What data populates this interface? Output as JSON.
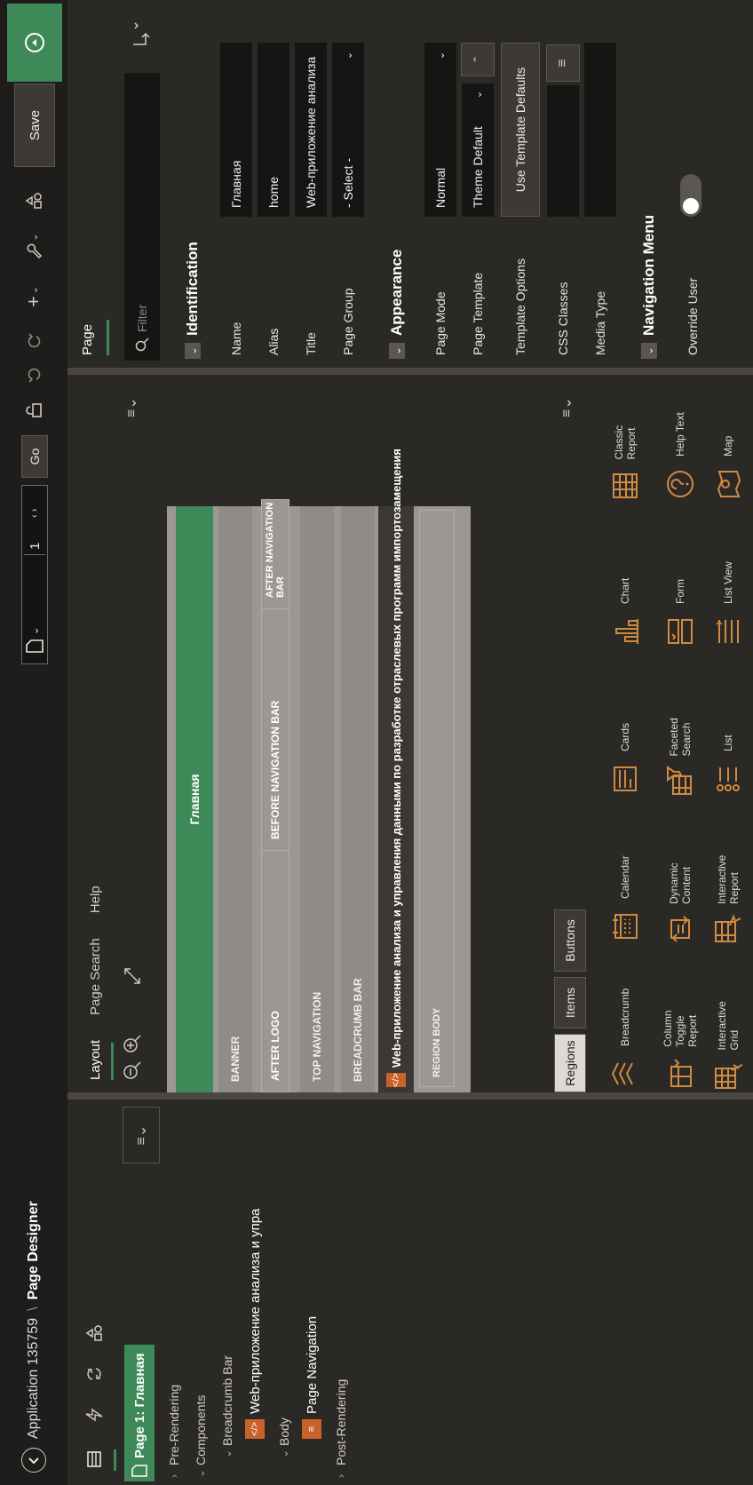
{
  "header": {
    "app_label": "Application 135759",
    "separator": "\\",
    "title": "Page Designer",
    "page_number": "1",
    "go_label": "Go",
    "save_label": "Save"
  },
  "left_panel": {
    "tree": [
      {
        "label": "Page 1: Главная",
        "selected": true
      },
      {
        "label": "Pre-Rendering"
      },
      {
        "label": "Components"
      },
      {
        "label": "Breadcrumb Bar"
      },
      {
        "label": "Web-приложение анализа и упра"
      },
      {
        "label": "Body"
      },
      {
        "label": "Page Navigation"
      },
      {
        "label": "Post-Rendering"
      }
    ]
  },
  "center": {
    "tabs": [
      "Layout",
      "Page Search",
      "Help"
    ],
    "layout": {
      "page_title": "Главная",
      "rows": {
        "banner": "BANNER",
        "after_logo": "AFTER LOGO",
        "before_nav": "BEFORE NAVIGATION BAR",
        "after_nav": "AFTER NAVIGATION BAR",
        "top_nav": "TOP NAVIGATION",
        "breadcrumb": "BREADCRUMB BAR",
        "region_title": "Web-приложение анализа и управления данными по разработке отраслевых программ импортозамещения",
        "region_body": "REGION BODY"
      }
    },
    "gallery": {
      "tabs": [
        "Regions",
        "Items",
        "Buttons"
      ],
      "items": [
        "Breadcrumb",
        "Calendar",
        "Cards",
        "Chart",
        "Classic Report",
        "Column Toggle Report",
        "Dynamic Content",
        "Faceted Search",
        "Form",
        "Help Text",
        "Interactive Grid",
        "Interactive Report",
        "List",
        "List View",
        "Map"
      ]
    }
  },
  "right_panel": {
    "tab": "Page",
    "filter_placeholder": "Filter",
    "identification": {
      "title": "Identification",
      "name_label": "Name",
      "name_value": "Главная",
      "alias_label": "Alias",
      "alias_value": "home",
      "title_label": "Title",
      "title_value": "Web-приложение анализа",
      "group_label": "Page Group",
      "group_value": "- Select -"
    },
    "appearance": {
      "title": "Appearance",
      "mode_label": "Page Mode",
      "mode_value": "Normal",
      "template_label": "Page Template",
      "template_value": "Theme Default",
      "options_label": "Template Options",
      "options_value": "Use Template Defaults",
      "css_label": "CSS Classes",
      "media_label": "Media Type"
    },
    "navigation": {
      "title": "Navigation Menu",
      "override_label": "Override User"
    }
  },
  "colors": {
    "accent": "#3d8a58",
    "brand_orange": "#c8622a",
    "icon_orange": "#d08a42"
  }
}
